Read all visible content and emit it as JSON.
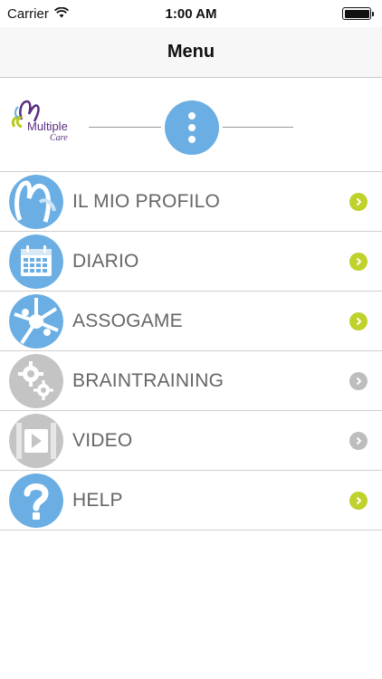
{
  "status_bar": {
    "carrier": "Carrier",
    "time": "1:00 AM",
    "wifi_icon": "wifi-icon",
    "battery_icon": "battery-icon"
  },
  "nav": {
    "title": "Menu"
  },
  "header": {
    "logo_line1": "Multiple",
    "logo_line2": "Care",
    "more_icon": "more-vertical-icon"
  },
  "menu": {
    "items": [
      {
        "label": "IL MIO PROFILO",
        "icon": "profile-icon",
        "enabled": true
      },
      {
        "label": "DIARIO",
        "icon": "calendar-icon",
        "enabled": true
      },
      {
        "label": "ASSOGAME",
        "icon": "game-icon",
        "enabled": true
      },
      {
        "label": "BRAINTRAINING",
        "icon": "gears-icon",
        "enabled": false
      },
      {
        "label": "VIDEO",
        "icon": "video-play-icon",
        "enabled": false
      },
      {
        "label": "HELP",
        "icon": "help-icon",
        "enabled": true
      }
    ]
  },
  "colors": {
    "accent_blue": "#6aaee3",
    "chevron_active": "#bfd12b",
    "chevron_inactive": "#bdbdbd",
    "label_gray": "#666666",
    "logo_purple": "#5a2d82"
  }
}
